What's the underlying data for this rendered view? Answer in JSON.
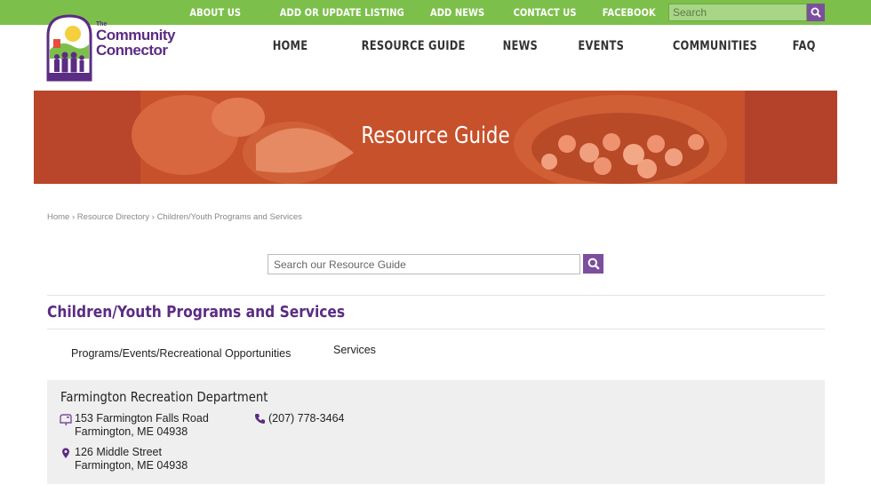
{
  "topnav": {
    "items": [
      "ABOUT US",
      "ADD OR UPDATE LISTING",
      "ADD NEWS",
      "CONTACT US",
      "FACEBOOK"
    ],
    "search_placeholder": "Search"
  },
  "logo": {
    "the": "The",
    "line1": "Community",
    "line2": "Connector"
  },
  "mainnav": {
    "items": [
      "HOME",
      "RESOURCE GUIDE",
      "NEWS",
      "EVENTS",
      "COMMUNITIES",
      "FAQ"
    ]
  },
  "hero": {
    "title": "Resource Guide"
  },
  "breadcrumb": {
    "items": [
      "Home",
      "Resource Directory",
      "Children/Youth Programs and Services"
    ],
    "sep": "›"
  },
  "guide_search": {
    "placeholder": "Search our Resource Guide"
  },
  "section": {
    "title": "Children/Youth Programs and Services",
    "categories": [
      "Programs/Events/Recreational Opportunities",
      "Services"
    ]
  },
  "listing": {
    "name": "Farmington Recreation Department",
    "mailing_address": [
      "153 Farmington Falls Road",
      "Farmington, ME 04938"
    ],
    "physical_address": [
      "126 Middle Street",
      "Farmington, ME 04938"
    ],
    "phone": "(207) 778-3464"
  },
  "colors": {
    "green": "#7cc04b",
    "purple": "#7b4f9d",
    "title_purple": "#5b2c83",
    "hero": "#c94c27"
  }
}
